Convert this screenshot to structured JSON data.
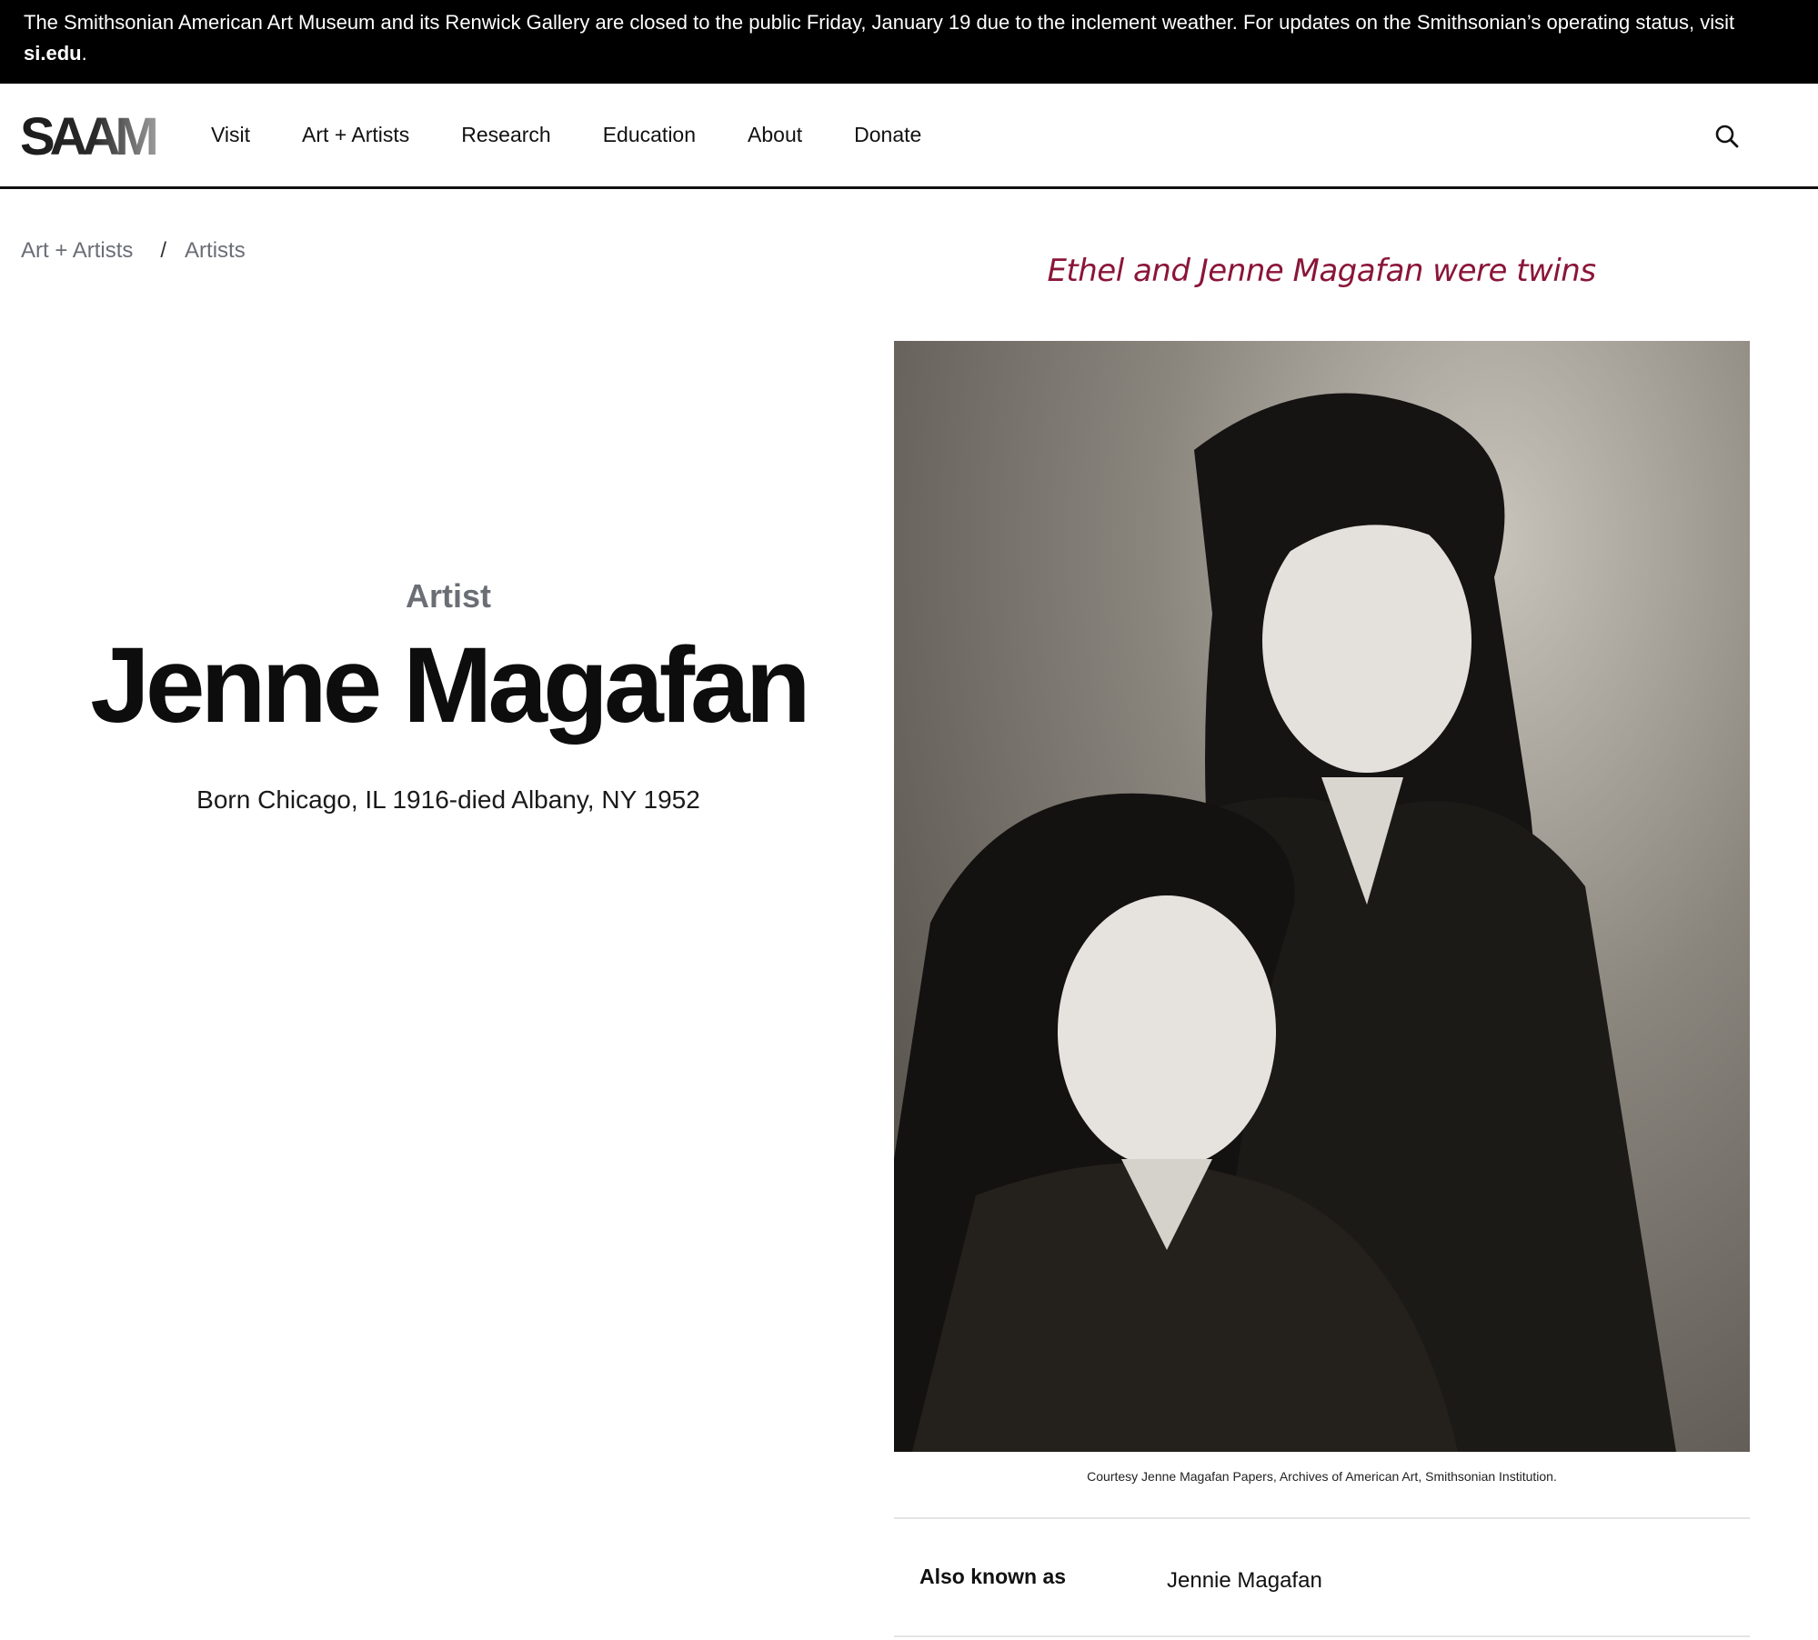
{
  "alert": {
    "text": "The Smithsonian American Art Museum and its Renwick Gallery are closed to the public Friday, January 19 due to the inclement weather. For updates on the Smithsonian’s operating status, visit ",
    "link_text": "si.edu",
    "suffix": "."
  },
  "header": {
    "logo_text": "SAAM",
    "nav": [
      "Visit",
      "Art + Artists",
      "Research",
      "Education",
      "About",
      "Donate"
    ],
    "search_icon": "search-icon"
  },
  "breadcrumb": {
    "items": [
      "Art + Artists",
      "Artists"
    ],
    "separator": "/"
  },
  "artist": {
    "kicker": "Artist",
    "name": "Jenne Magafan",
    "dates": "Born Chicago, IL 1916-died Albany, NY 1952"
  },
  "photo": {
    "heading": "Ethel and Jenne Magafan were twins",
    "caption": "Courtesy Jenne Magafan Papers, Archives of American Art, Smithsonian Institution."
  },
  "details": [
    {
      "label": "Also known as",
      "value": "Jennie Magafan"
    }
  ],
  "colors": {
    "banner_bg": "#000000",
    "accent": "#8a1538",
    "muted": "#6b6e75"
  }
}
